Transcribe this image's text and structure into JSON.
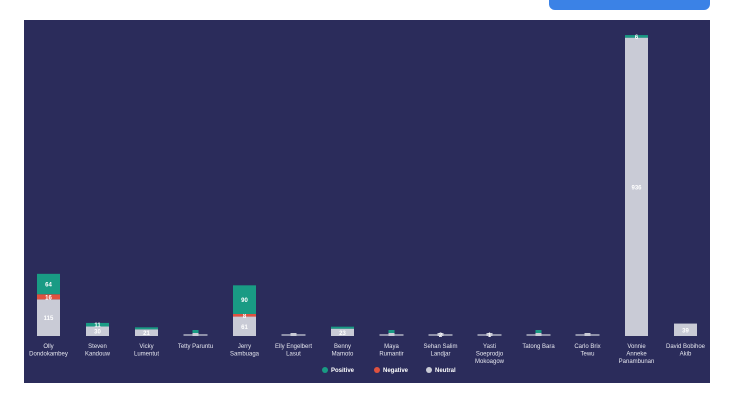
{
  "header": {
    "action_button_label": ""
  },
  "chart_data": {
    "type": "bar",
    "stacked": true,
    "background": "#2b2c5b",
    "grid": false,
    "legend_position": "bottom",
    "categories": [
      "Olly\nDondokambey",
      "Steven\nKandouw",
      "Vicky\nLumentut",
      "Tetty Paruntu",
      "Jerry\nSambuaga",
      "Elly Engelbert\nLasut",
      "Benny\nMamoto",
      "Maya\nRumantir",
      "Sehan Salim\nLandjar",
      "Yasti\nSoeprodjo\nMokoagow",
      "Tatong Bara",
      "Carlo Brix\nTewu",
      "Vonnie\nAnneke\nPanambunan",
      "David Bobihoe\nAkib"
    ],
    "series": [
      {
        "name": "Neutral",
        "color": "#c9cbd6",
        "values": [
          115,
          30,
          21,
          5,
          61,
          1,
          23,
          3,
          2,
          1,
          3,
          3,
          936,
          39
        ],
        "labels": [
          "115",
          "30",
          "21",
          "",
          "61",
          "",
          "23",
          "",
          "2",
          "1",
          "",
          "",
          "936",
          "39"
        ]
      },
      {
        "name": "Negative",
        "color": "#e0523f",
        "values": [
          16,
          0,
          0,
          0,
          8,
          0,
          0,
          0,
          0,
          0,
          0,
          0,
          0,
          0
        ],
        "labels": [
          "16",
          "",
          "",
          "",
          "8",
          "",
          "",
          "",
          "",
          "",
          "",
          "",
          "",
          ""
        ]
      },
      {
        "name": "Positive",
        "color": "#199b84",
        "values": [
          64,
          11,
          5,
          1,
          90,
          0,
          5,
          1,
          0,
          0,
          1,
          0,
          8,
          0
        ],
        "labels": [
          "64",
          "11",
          "",
          "",
          "90",
          "",
          "",
          "",
          "",
          "",
          "",
          "",
          "6",
          ""
        ]
      }
    ],
    "legend": [
      "Positive",
      "Negative",
      "Neutral"
    ],
    "ylim": [
      0,
      960
    ]
  },
  "caption": {
    "text": ""
  }
}
